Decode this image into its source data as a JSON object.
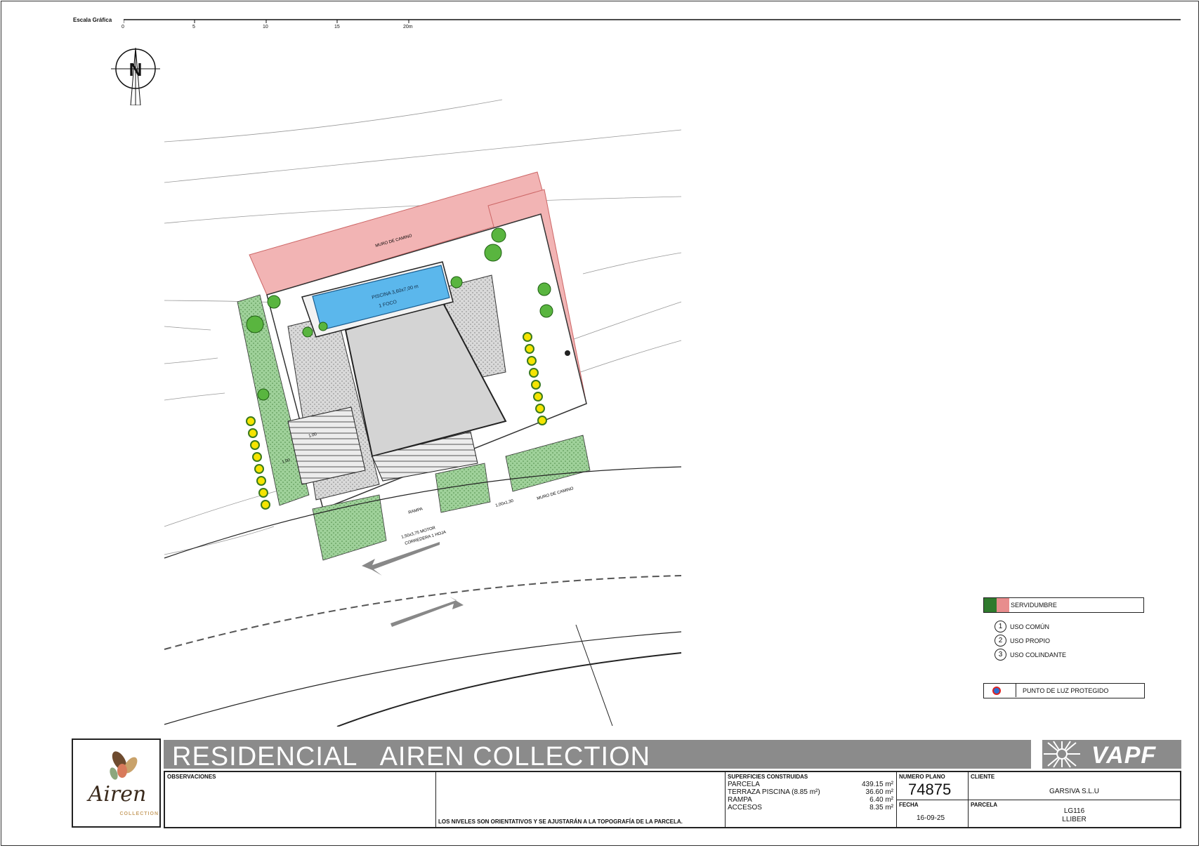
{
  "scale": {
    "title": "Escala Gráfica",
    "ticks": [
      "0",
      "5",
      "10",
      "15",
      "20m"
    ]
  },
  "north": {
    "letter": "N"
  },
  "plan_labels": {
    "pool": "PISCINA 3,60x7,00 m",
    "pool_sub": "1 FOCO",
    "wall_top": "MURO DE CAMINO",
    "wall_bottom": "MURO DE CAMINO",
    "ramp": "RAMPA",
    "gate_car": "1,50x3,75 MOTOR",
    "gate_car_sub": "CORREDERA 1 HOJA",
    "gate_person": "1,00x1,30",
    "dim1": "1.00",
    "dim2": "1.00"
  },
  "legend": {
    "servidumbre": "SERVIDUMBRE",
    "uses": [
      {
        "num": "1",
        "label": "USO COMÚN"
      },
      {
        "num": "2",
        "label": "USO PROPIO"
      },
      {
        "num": "3",
        "label": "USO COLINDANTE"
      }
    ],
    "luz": "PUNTO DE LUZ PROTEGIDO"
  },
  "title_block": {
    "project_title": "RESIDENCIAL   AIREN COLLECTION",
    "brand": "VAPF",
    "logo_main": "Airen",
    "logo_sub": "COLLECTION",
    "observaciones_label": "OBSERVACIONES",
    "note": "LOS NIVELES SON ORIENTATIVOS Y SE AJUSTARÁN A LA TOPOGRAFÍA DE LA PARCELA.",
    "superficies_label": "SUPERFICIES CONSTRUIDAS",
    "superficies": [
      {
        "name": "PARCELA",
        "value": "439.15 m²"
      },
      {
        "name": "TERRAZA PISCINA (8.85 m²)",
        "value": "36.60 m²"
      },
      {
        "name": "RAMPA",
        "value": "6.40 m²"
      },
      {
        "name": "ACCESOS",
        "value": "8.35 m²"
      }
    ],
    "numero_plano_label": "NUMERO PLANO",
    "numero_plano": "74875",
    "fecha_label": "FECHA",
    "fecha": "16-09-25",
    "cliente_label": "CLIENTE",
    "cliente": "GARSIVA S.L.U",
    "parcela_label": "PARCELA",
    "parcela_1": "LG116",
    "parcela_2": "LLIBER"
  },
  "colors": {
    "servidumbre_green": "#2f7a2d",
    "servidumbre_pink": "#e88d8d",
    "pool_blue": "#5bb7ec",
    "banner_gray": "#8b8b8b"
  }
}
